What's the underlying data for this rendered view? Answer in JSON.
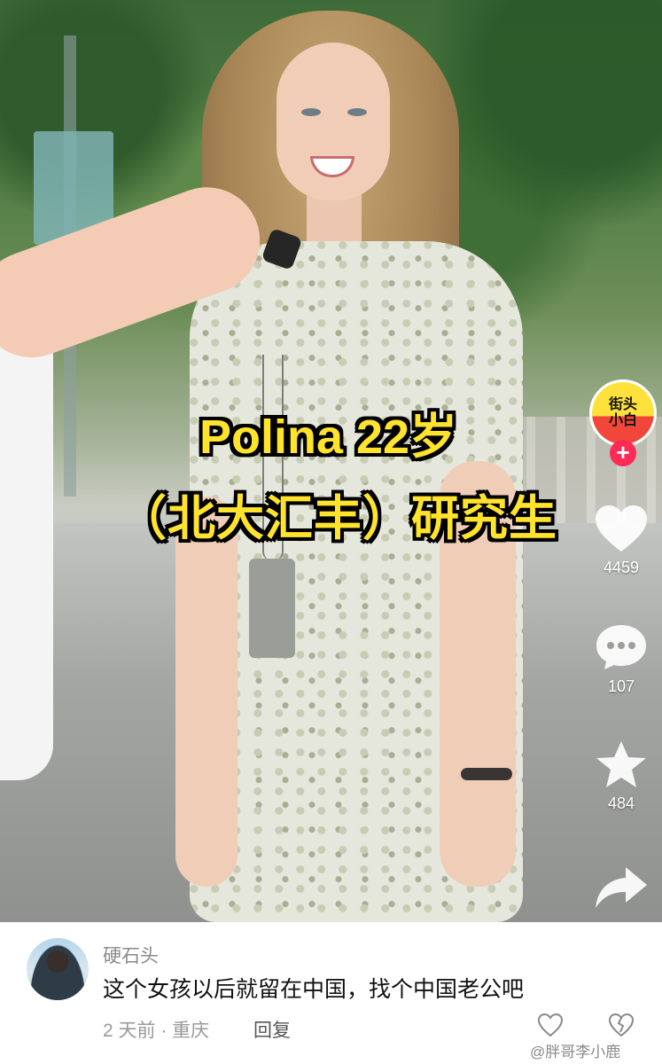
{
  "video": {
    "caption_line1": "Polina 22岁",
    "caption_line2": "（北大汇丰）研究生",
    "caption_color": "#ffe32c"
  },
  "sidebar": {
    "account_avatar_text": "街头\n小白",
    "follow_label": "+",
    "likes": "4459",
    "comments": "107",
    "favorites": "484",
    "icons": [
      "heart-icon",
      "comment-icon",
      "star-icon",
      "share-icon"
    ]
  },
  "comment": {
    "author": "硬石头",
    "text": "这个女孩以后就留在中国，找个中国老公吧",
    "meta": "2 天前 · 重庆",
    "reply_label": "回复",
    "watermark": "@胖哥李小鹿"
  },
  "colors": {
    "follow": "#fe2c55",
    "background": "#ffffff"
  }
}
